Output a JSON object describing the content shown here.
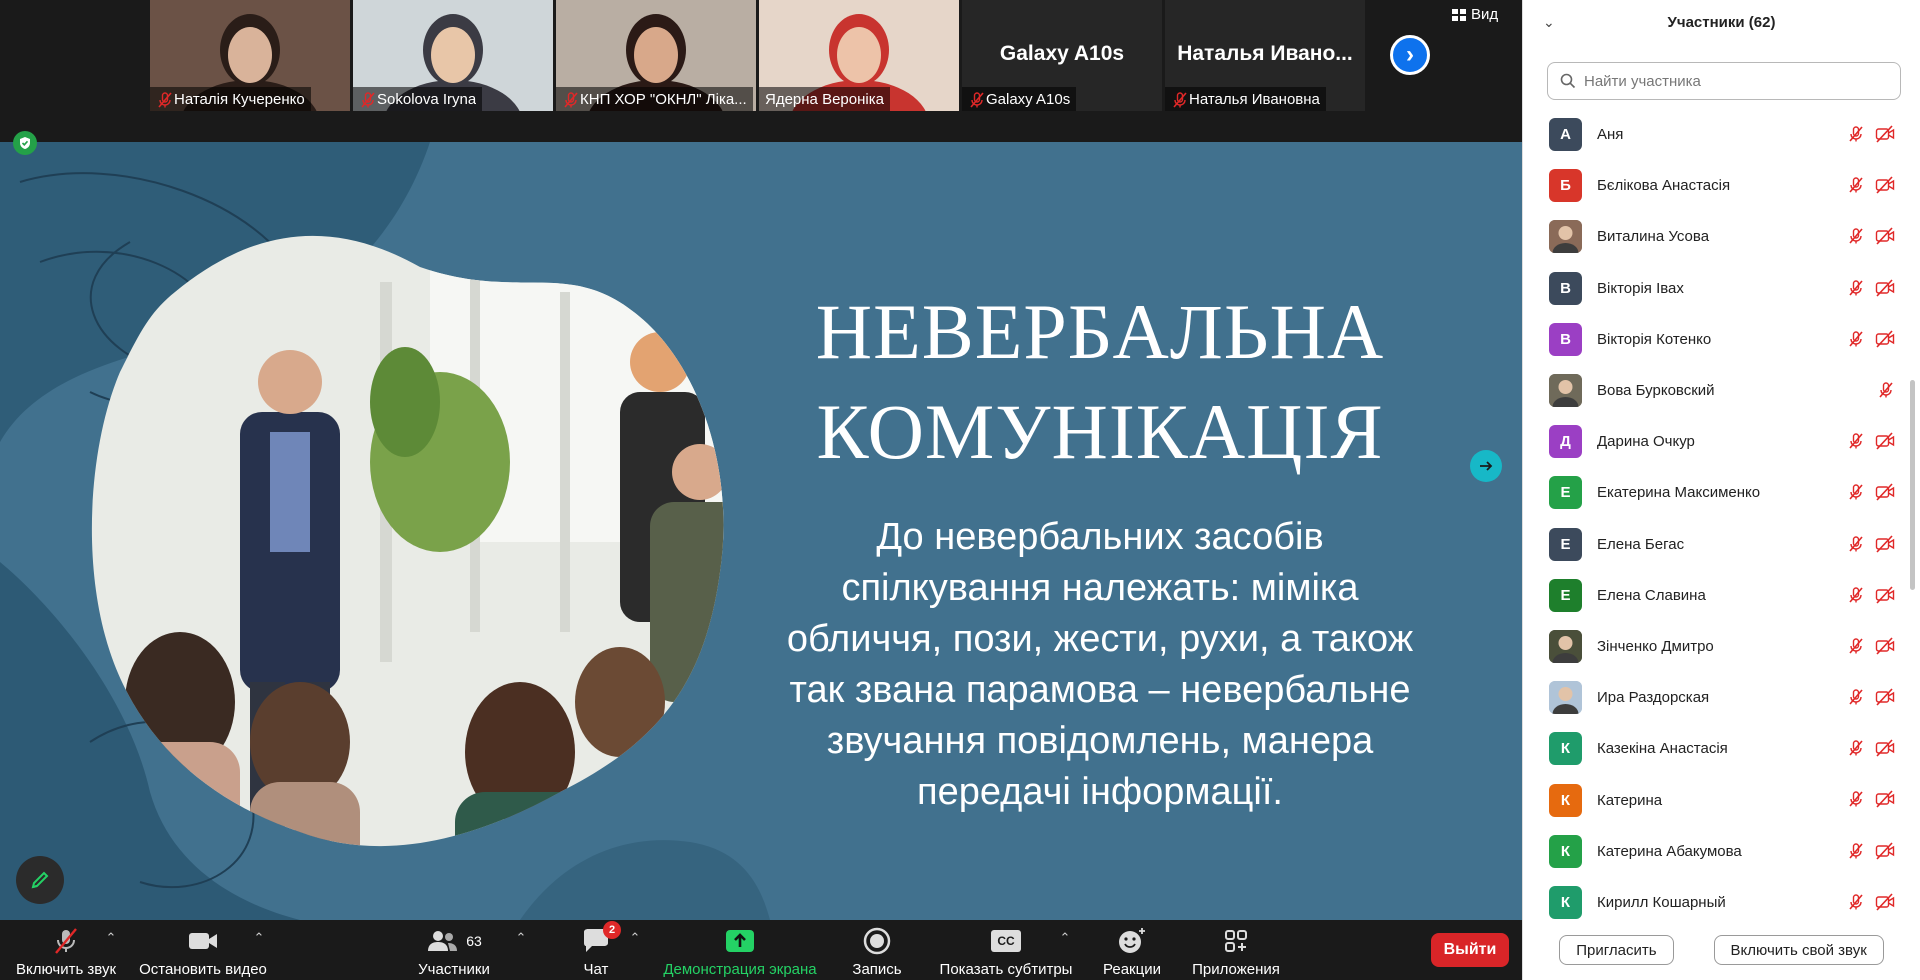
{
  "thumbnails": [
    {
      "name": "Наталія Кучеренко",
      "mic_muted": true,
      "type": "video",
      "colors": [
        "#6b5246",
        "#d9b39a",
        "#2a1d18"
      ]
    },
    {
      "name": "Sokolova Iryna",
      "mic_muted": true,
      "type": "video",
      "colors": [
        "#cfd6d9",
        "#e8c6a8",
        "#3b3b44"
      ]
    },
    {
      "name": "КНП ХОР \"ОКНЛ\" Ліка...",
      "mic_muted": true,
      "type": "video",
      "colors": [
        "#b9aea3",
        "#d8a88a",
        "#2b1a16"
      ]
    },
    {
      "name": "Ядерна Вероніка",
      "mic_muted": false,
      "type": "video",
      "speaking": true,
      "colors": [
        "#e6d6c9",
        "#edc3a9",
        "#c8342f"
      ]
    },
    {
      "name": "Galaxy A10s",
      "mic_muted": true,
      "type": "name",
      "display": "Galaxy A10s"
    },
    {
      "name": "Наталья Ивановна",
      "mic_muted": true,
      "type": "name",
      "display": "Наталья Ивано..."
    }
  ],
  "view_label": "Вид",
  "slide": {
    "title_lines": [
      "НЕВЕРБАЛЬНА",
      "КОМУНІКАЦІЯ"
    ],
    "body": "До невербальних засобів спілкування належать: міміка обличчя, пози, жести, рухи, а також так звана парамова – невербальне звучання повідомлень, манера передачі інформації."
  },
  "toolbar": {
    "unmute": "Включить звук",
    "stop_video": "Остановить видео",
    "participants": "Участники",
    "participants_count": "63",
    "chat": "Чат",
    "chat_badge": "2",
    "share": "Демонстрация экрана",
    "record": "Запись",
    "captions": "Показать субтитры",
    "captions_icon": "CC",
    "reactions": "Реакции",
    "apps": "Приложения",
    "leave": "Выйти"
  },
  "panel": {
    "title": "Участники (62)",
    "search_placeholder": "Найти участника",
    "invite": "Пригласить",
    "unmute_self": "Включить свой звук",
    "participants": [
      {
        "name": "Аня",
        "initial": "А",
        "color": "#3c4a5c",
        "video_off": true
      },
      {
        "name": "Бєлікова Анастасія",
        "initial": "Б",
        "color": "#d8362a",
        "video_off": true
      },
      {
        "name": "Виталина Усова",
        "initial": "",
        "color": "#8a6a58",
        "photo": true,
        "video_off": true
      },
      {
        "name": "Вікторія Івах",
        "initial": "В",
        "color": "#3c4a5c",
        "video_off": true
      },
      {
        "name": "Вікторія Котенко",
        "initial": "В",
        "color": "#9b3fc4",
        "video_off": true
      },
      {
        "name": "Вова Бурковский",
        "initial": "",
        "color": "#6f6a5a",
        "photo": true,
        "video_off": false
      },
      {
        "name": "Дарина Очкур",
        "initial": "Д",
        "color": "#9b3fc4",
        "video_off": true
      },
      {
        "name": "Екатерина Максименко",
        "initial": "Е",
        "color": "#24a148",
        "video_off": true
      },
      {
        "name": "Елена Бегас",
        "initial": "Е",
        "color": "#3c4a5c",
        "video_off": true
      },
      {
        "name": "Елена Славина",
        "initial": "Е",
        "color": "#1e7f2c",
        "video_off": true
      },
      {
        "name": "Зінченко Дмитро",
        "initial": "",
        "color": "#4a4f3a",
        "photo": true,
        "video_off": true
      },
      {
        "name": "Ира Раздорская",
        "initial": "",
        "color": "#b0c4d8",
        "photo": true,
        "video_off": true
      },
      {
        "name": "Казекіна Анастасія",
        "initial": "К",
        "color": "#1f9c6b",
        "video_off": true
      },
      {
        "name": "Катерина",
        "initial": "К",
        "color": "#e66a0f",
        "video_off": true
      },
      {
        "name": "Катерина Абакумова",
        "initial": "К",
        "color": "#24a148",
        "video_off": true
      },
      {
        "name": "Кирилл Кошарный",
        "initial": "К",
        "color": "#1f9c6b",
        "video_off": true
      }
    ]
  }
}
